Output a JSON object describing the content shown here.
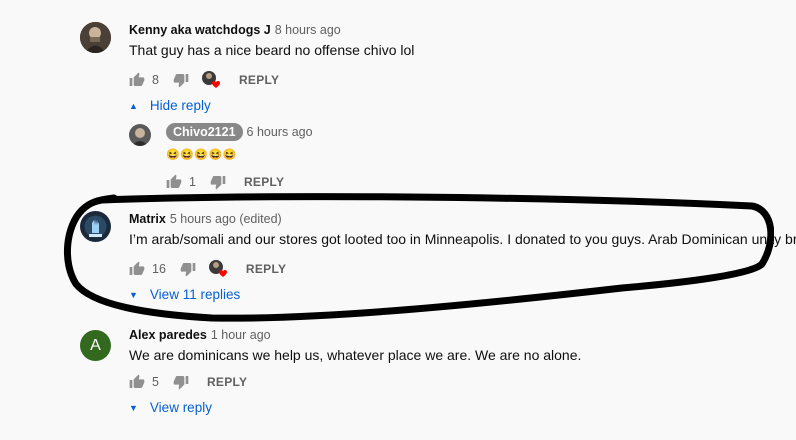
{
  "comments": [
    {
      "author": "Kenny aka watchdogs J",
      "time": "8 hours ago",
      "text": "That guy has a nice beard no offense chivo lol",
      "likes": "8",
      "reply_label": "REPLY",
      "toggle_label": "Hide reply",
      "icons": [
        "like-icon",
        "dislike-icon",
        "creator-heart-icon"
      ]
    },
    {
      "author": "Chivo2121",
      "time": "6 hours ago",
      "text": "😆😆😆😆😆",
      "likes": "1",
      "reply_label": "REPLY",
      "is_reply": true
    },
    {
      "author": "Matrix",
      "time": "5 hours ago (edited)",
      "text": "I’m arab/somali and our stores got looted too in Minneapolis. I donated to you guys. Arab Dominican unity bro",
      "likes": "16",
      "reply_label": "REPLY",
      "toggle_label": "View 11 replies"
    },
    {
      "author": "Alex paredes",
      "avatar_letter": "A",
      "time": "1 hour ago",
      "text": "We are dominicans we help us, whatever place we are. We are no alone.",
      "likes": "5",
      "reply_label": "REPLY",
      "toggle_label": "View reply"
    }
  ],
  "colors": {
    "link": "#065fd4",
    "heart": "#ff0000",
    "annotation": "#000000",
    "avatar_alex": "#33691e",
    "channel_chip": "#888888"
  }
}
